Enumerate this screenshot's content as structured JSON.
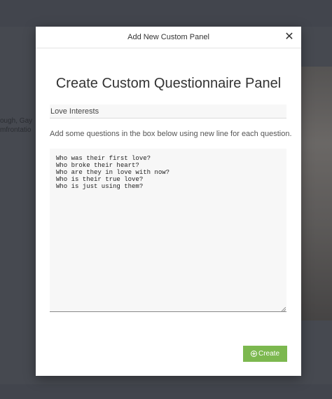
{
  "background": {
    "partial_text": [
      "ough, Gay",
      "mfrontatio"
    ]
  },
  "modal": {
    "title": "Add New Custom Panel",
    "close_icon": "close-icon",
    "heading": "Create Custom Questionnaire Panel",
    "panel_name": {
      "value": "Love Interests"
    },
    "instructions": "Add some questions in the box below using new line for each question.",
    "questions_text": "Who was their first love?\nWho broke their heart?\nWho are they in love with now?\nWho is their true love?\nWho is just using them?",
    "create_button": {
      "label": "Create",
      "icon": "plus-circle-icon",
      "color": "#7cb84f"
    }
  }
}
